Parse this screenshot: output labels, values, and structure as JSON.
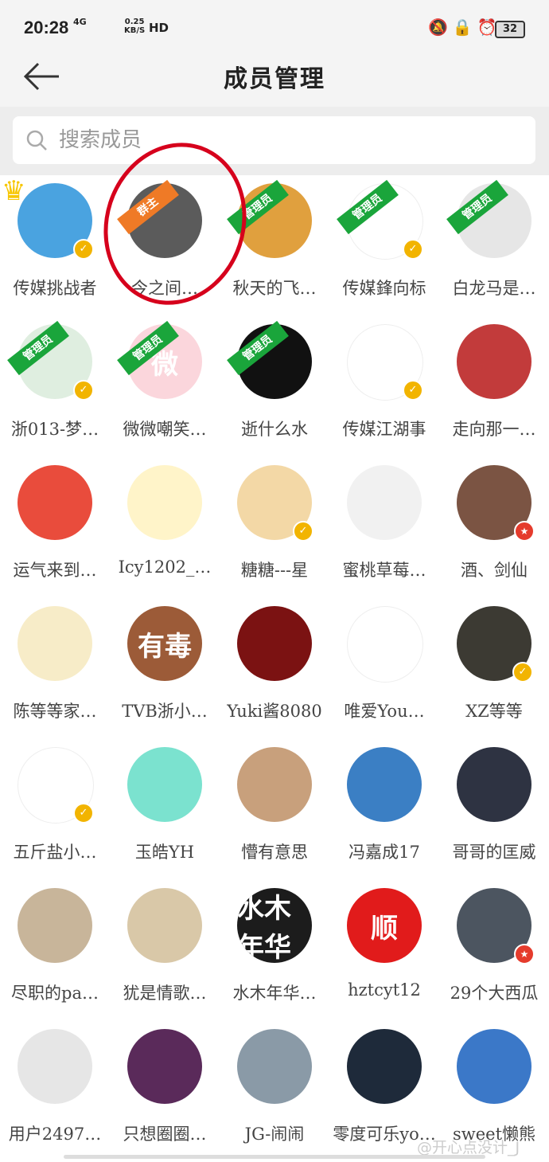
{
  "status": {
    "time": "20:28",
    "network": "4G",
    "speed_value": "0.25",
    "speed_unit": "KB/S",
    "hd": "HD",
    "battery": "32"
  },
  "nav": {
    "title": "成员管理",
    "back_icon": "arrow-left-icon"
  },
  "search": {
    "placeholder": "搜索成员",
    "value": ""
  },
  "members": [
    {
      "name": "传媒挑战者",
      "bg": "#4aa3e0",
      "role": "",
      "badge": "v",
      "crown": true
    },
    {
      "name": "今之间…",
      "bg": "#5b5b5b",
      "role": "群主",
      "badge": ""
    },
    {
      "name": "秋天的飞…",
      "bg": "#e0a03e",
      "role": "管理员",
      "badge": ""
    },
    {
      "name": "传媒鋒向标",
      "bg": "#ffffff",
      "role": "管理员",
      "badge": "v"
    },
    {
      "name": "白龙马是…",
      "bg": "#e6e6e6",
      "role": "管理员",
      "badge": ""
    },
    {
      "name": "浙013-梦…",
      "bg": "#dfeee0",
      "role": "管理员",
      "badge": "v"
    },
    {
      "name": "微微嘲笑…",
      "bg": "#fbd6dc",
      "role": "管理员",
      "badge": "",
      "glyph": "微"
    },
    {
      "name": "逝什么水",
      "bg": "#111111",
      "role": "管理员",
      "badge": ""
    },
    {
      "name": "传媒江湖事",
      "bg": "#ffffff",
      "role": "",
      "badge": "v"
    },
    {
      "name": "走向那一…",
      "bg": "#c23b3b",
      "role": "",
      "badge": ""
    },
    {
      "name": "运气来到…",
      "bg": "#e94c3c",
      "role": "",
      "badge": ""
    },
    {
      "name": "Icy1202_…",
      "bg": "#fff4c9",
      "role": "",
      "badge": ""
    },
    {
      "name": "糖糖---星",
      "bg": "#f3d8a6",
      "role": "",
      "badge": "v"
    },
    {
      "name": "蜜桃草莓…",
      "bg": "#f1f1f1",
      "role": "",
      "badge": ""
    },
    {
      "name": "酒、剑仙",
      "bg": "#7b5443",
      "role": "",
      "badge": "r"
    },
    {
      "name": "陈等等家…",
      "bg": "#f7ecc8",
      "role": "",
      "badge": ""
    },
    {
      "name": "TVB浙小…",
      "bg": "#9c5b38",
      "role": "",
      "badge": "",
      "glyph": "有毒"
    },
    {
      "name": "Yuki酱8080",
      "bg": "#7b1212",
      "role": "",
      "badge": ""
    },
    {
      "name": "唯爱You…",
      "bg": "#ffffff",
      "role": "",
      "badge": ""
    },
    {
      "name": "XZ等等",
      "bg": "#3c3a33",
      "role": "",
      "badge": "v"
    },
    {
      "name": "五斤盐小…",
      "bg": "#ffffff",
      "role": "",
      "badge": "v"
    },
    {
      "name": "玉皓YH",
      "bg": "#7be2cf",
      "role": "",
      "badge": ""
    },
    {
      "name": "懵有意思",
      "bg": "#c8a07c",
      "role": "",
      "badge": ""
    },
    {
      "name": "冯嘉成17",
      "bg": "#3b7fc4",
      "role": "",
      "badge": ""
    },
    {
      "name": "哥哥的匡威",
      "bg": "#2e3342",
      "role": "",
      "badge": ""
    },
    {
      "name": "尽职的pa…",
      "bg": "#c8b59a",
      "role": "",
      "badge": ""
    },
    {
      "name": "犹是情歌…",
      "bg": "#d9c8a8",
      "role": "",
      "badge": ""
    },
    {
      "name": "水木年华…",
      "bg": "#1c1c1c",
      "role": "",
      "badge": "",
      "glyph": "水木年华"
    },
    {
      "name": "hztcyt12",
      "bg": "#e11b1b",
      "role": "",
      "badge": "",
      "glyph": "顺"
    },
    {
      "name": "29个大西瓜",
      "bg": "#4c5560",
      "role": "",
      "badge": "r"
    },
    {
      "name": "用户2497…",
      "bg": "#e6e6e6",
      "role": "",
      "badge": ""
    },
    {
      "name": "只想圈圈…",
      "bg": "#5a2a5a",
      "role": "",
      "badge": ""
    },
    {
      "name": "JG-闹闹",
      "bg": "#8a9aa7",
      "role": "",
      "badge": ""
    },
    {
      "name": "零度可乐yo…",
      "bg": "#1e2a3a",
      "role": "",
      "badge": ""
    },
    {
      "name": "sweet懒熊",
      "bg": "#3b78c8",
      "role": "",
      "badge": ""
    }
  ],
  "watermark": "@开心点没计_J"
}
